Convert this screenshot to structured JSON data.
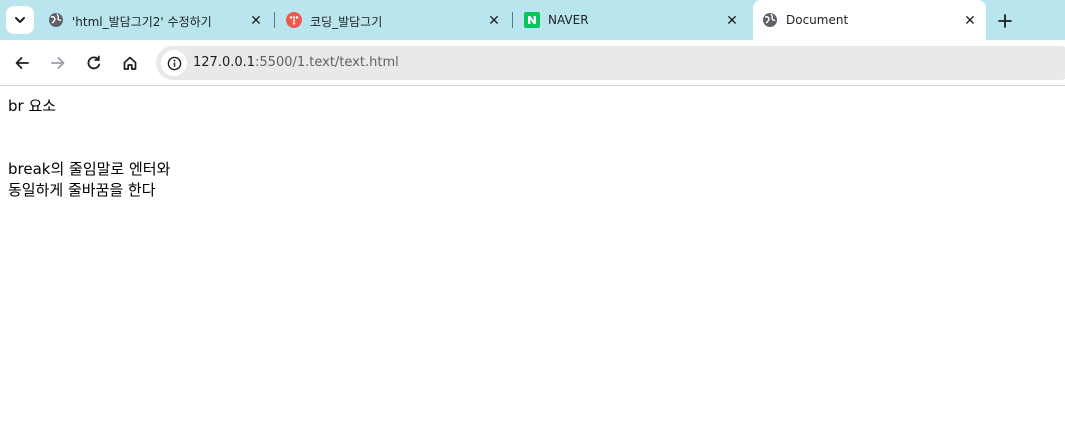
{
  "browser": {
    "tabs": [
      {
        "title": "'html_발담그기2' 수정하기",
        "icon": "globe-icon"
      },
      {
        "title": "코딩_발담그기",
        "icon": "tistory-icon"
      },
      {
        "title": "NAVER",
        "icon": "naver-icon"
      },
      {
        "title": "Document",
        "icon": "globe-icon",
        "active": true
      }
    ],
    "address": {
      "host": "127.0.0.1",
      "rest": ":5500/1.text/text.html"
    },
    "colors": {
      "tabstrip": "#b9e5ef",
      "naver": "#03c75a",
      "tistory": "#f1584b"
    }
  },
  "page": {
    "line1": "br 요소",
    "line2": "break의 줄임말로 엔터와",
    "line3": "동일하게 줄바꿈을 한다"
  }
}
